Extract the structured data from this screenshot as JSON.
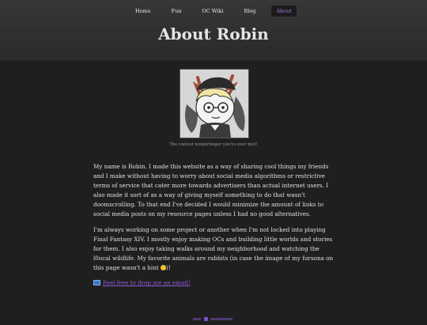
{
  "nav": {
    "items": [
      {
        "label": "Home"
      },
      {
        "label": "Fun"
      },
      {
        "label": "OC Wiki"
      },
      {
        "label": "Blog"
      },
      {
        "label": "About",
        "active": true
      }
    ]
  },
  "page_title": "About Robin",
  "avatar": {
    "caption": "The coolest wolpertinger you've ever met!"
  },
  "content": {
    "paragraph1": "My name is Robin. I made this website as a way of sharing cool things my friends and I make without having to worry about social media algorithms or restrictive terms of service that cater more towards advertisers than actual internet users. I also made it sort of as a way of giving myself something to do that wasn't doomscrolling. To that end I've decided I would minimize the amount of links to social media posts on my resource pages unless I had no good alternatives.",
    "paragraph2_text": "I'm always working on some project or another when I'm not locked into playing Final Fantasy XIV. I mostly enjoy making OCs and building little worlds and stories for them. I also enjoy taking walks around my neighborhood and watching the l0ocal wildlife. My favorite animals are rabbits (in case the image of my fursona on this page wasn't a hint",
    "paragraph2_end": ")!",
    "email_link": "Feel free to drop me an email!"
  },
  "icons": {
    "mail": "envelope-icon",
    "wink": "winking-face-icon"
  },
  "colors": {
    "accent": "#a77be6",
    "link": "#8c5bd6",
    "background": "#1f1f1f",
    "header": "#333333"
  }
}
